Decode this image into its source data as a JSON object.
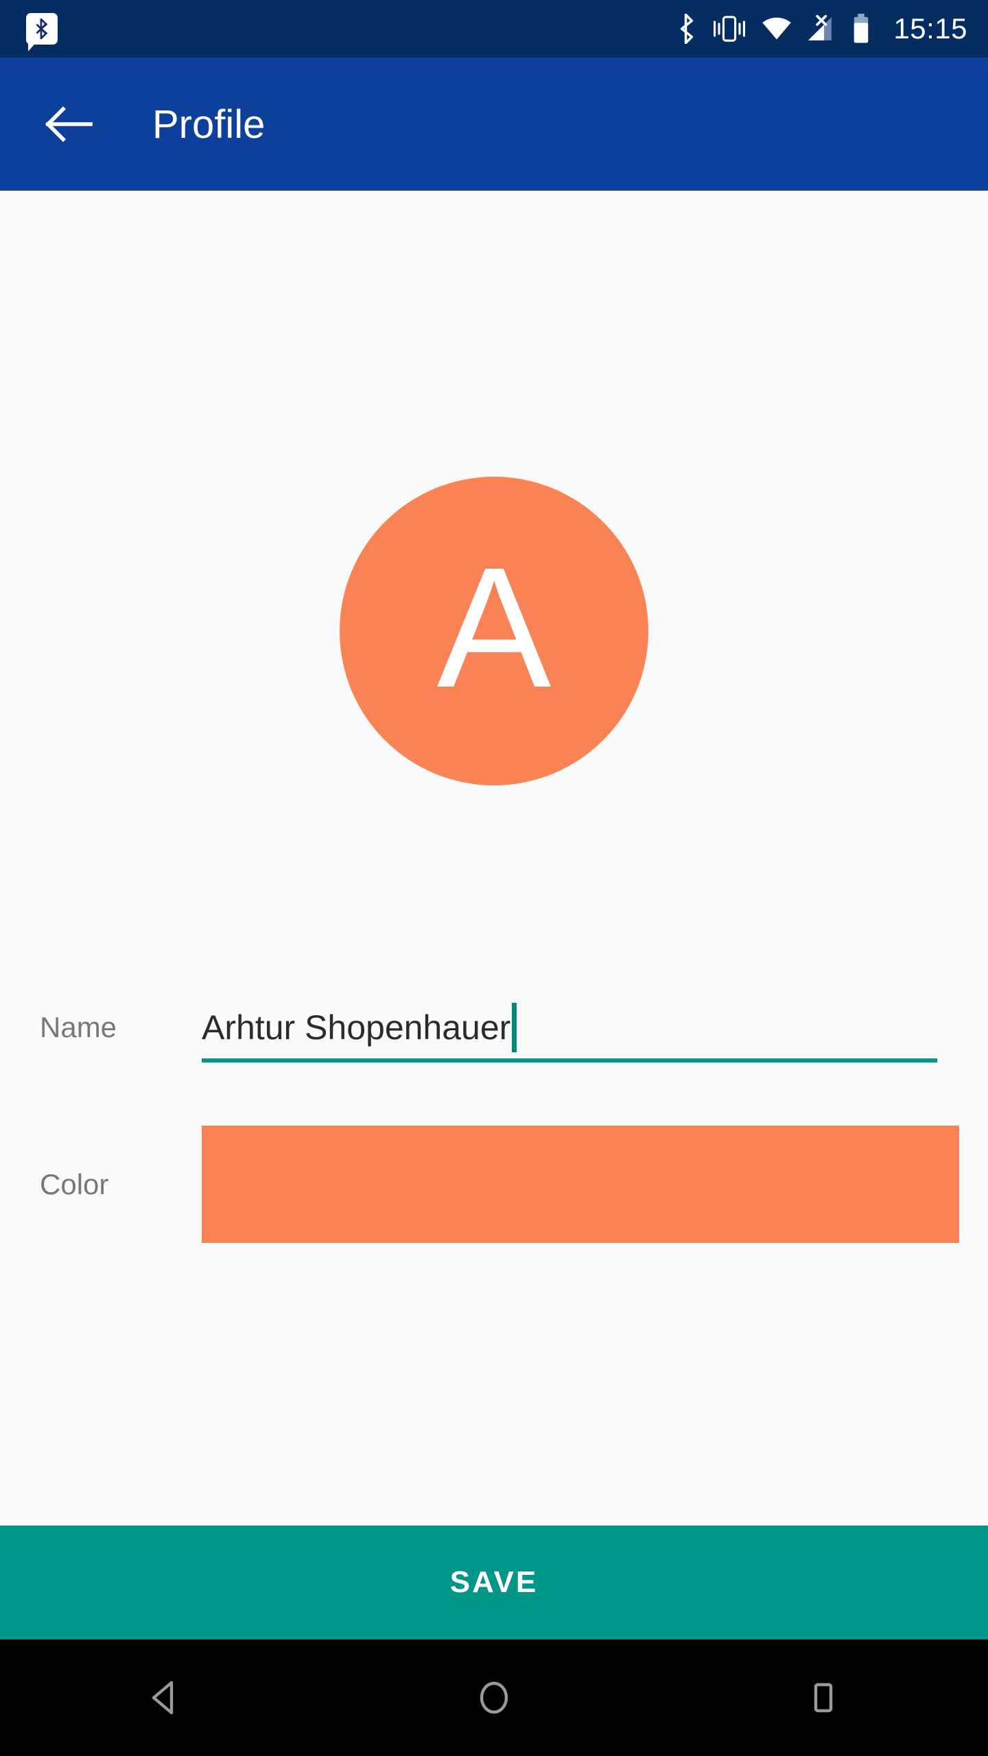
{
  "status_bar": {
    "background_color": "#062D61",
    "time": "15:15",
    "notification_icons": [
      "bluetooth-notification-icon"
    ],
    "system_icons": [
      "bluetooth-icon",
      "vibrate-icon",
      "wifi-icon",
      "cellular-signal-off-icon",
      "battery-icon"
    ]
  },
  "app_bar": {
    "background_color": "#0C409A",
    "back_icon": "arrow-left-icon",
    "title": "Profile"
  },
  "content": {
    "background_color": "#FAFAFA",
    "avatar": {
      "initial": "A",
      "color": "#F98354"
    },
    "display_name": "Arhtur Shopenhauer",
    "fields": [
      {
        "label": "Name",
        "value": "Arhtur Shopenhauer",
        "placeholder": "Name",
        "underline_color": "#009688",
        "caret_color": "#00897B",
        "focused": true
      },
      {
        "label": "Color",
        "value": "#F98354"
      }
    ]
  },
  "save_button": {
    "label": "SAVE",
    "background_color": "#009688",
    "text_color": "#FFFFFF"
  },
  "nav_bar": {
    "background_color": "#000000",
    "buttons": [
      {
        "name": "back",
        "icon": "triangle-back-icon"
      },
      {
        "name": "home",
        "icon": "circle-home-icon"
      },
      {
        "name": "recents",
        "icon": "square-recents-icon"
      }
    ]
  }
}
